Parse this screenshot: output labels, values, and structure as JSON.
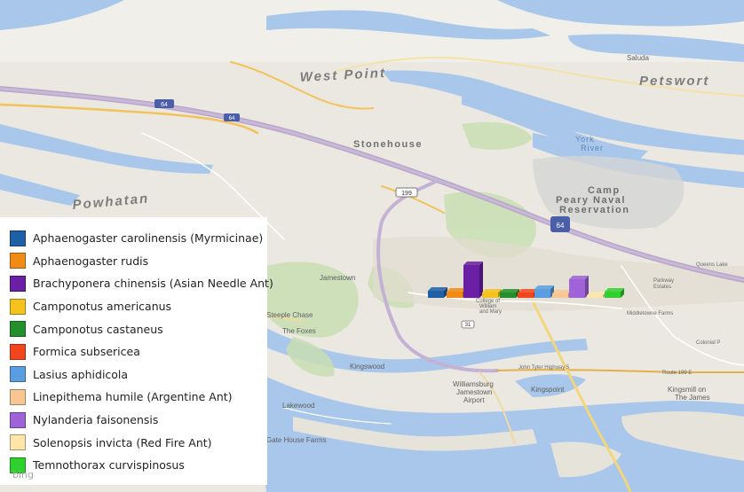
{
  "map": {
    "places": {
      "west_point": "West Point",
      "powhatan": "Powhatan",
      "stonehouse": "Stonehouse",
      "camp_peary": "Camp",
      "camp_peary_2": "Peary Naval",
      "camp_peary_3": "Reservation",
      "york_river_1": "York",
      "york_river_2": "River",
      "petsworth": "Petswort",
      "saluda": "Saluda",
      "jamestown": "Jamestown",
      "steeple_chase": "Steeple Chase",
      "the_foxes": "The Foxes",
      "kingswood": "Kingswood",
      "williamsburg_airport_1": "Williamsburg",
      "williamsburg_airport_2": "Jamestown",
      "williamsburg_airport_3": "Airport",
      "kingspoint": "Kingspoint",
      "kingsmill_1": "Kingsmill on",
      "kingsmill_2": "The James",
      "lakewood": "Lakewood",
      "gate_house_farms": "Gate House Farms",
      "middletowne_farms": "Middletowne Farms",
      "colonial_p": "Colonial P",
      "parkway_estates_1": "Parkway",
      "parkway_estates_2": "Estates",
      "queens_lake": "Queens Lake",
      "route_199e": "Route 199 E",
      "john_tyler_hwy": "John Tyler Highway 5",
      "college_wm": "College of",
      "college_wm_2": "William",
      "college_wm_3": "and Mary",
      "shield_64a": "64",
      "shield_64b": "64",
      "shield_199": "199",
      "shield_31": "31"
    },
    "logo": "bing"
  },
  "legend": {
    "items": [
      {
        "label": "Aphaenogaster carolinensis (Myrmicinae)",
        "color": "#1f5fa6"
      },
      {
        "label": "Aphaenogaster rudis",
        "color": "#f28a16"
      },
      {
        "label": "Brachyponera chinensis (Asian Needle Ant)",
        "color": "#6a1fa5"
      },
      {
        "label": "Camponotus americanus",
        "color": "#f6c31c"
      },
      {
        "label": "Camponotus castaneus",
        "color": "#23902d"
      },
      {
        "label": "Formica subsericea",
        "color": "#f2451e"
      },
      {
        "label": "Lasius aphidicola",
        "color": "#5a9de0"
      },
      {
        "label": "Linepithema humile (Argentine Ant)",
        "color": "#f7c692"
      },
      {
        "label": "Nylanderia faisonensis",
        "color": "#a062d8"
      },
      {
        "label": "Solenopsis invicta (Red Fire Ant)",
        "color": "#fde6a9"
      },
      {
        "label": "Temnothorax curvispinosus",
        "color": "#2fd12f"
      }
    ]
  }
}
